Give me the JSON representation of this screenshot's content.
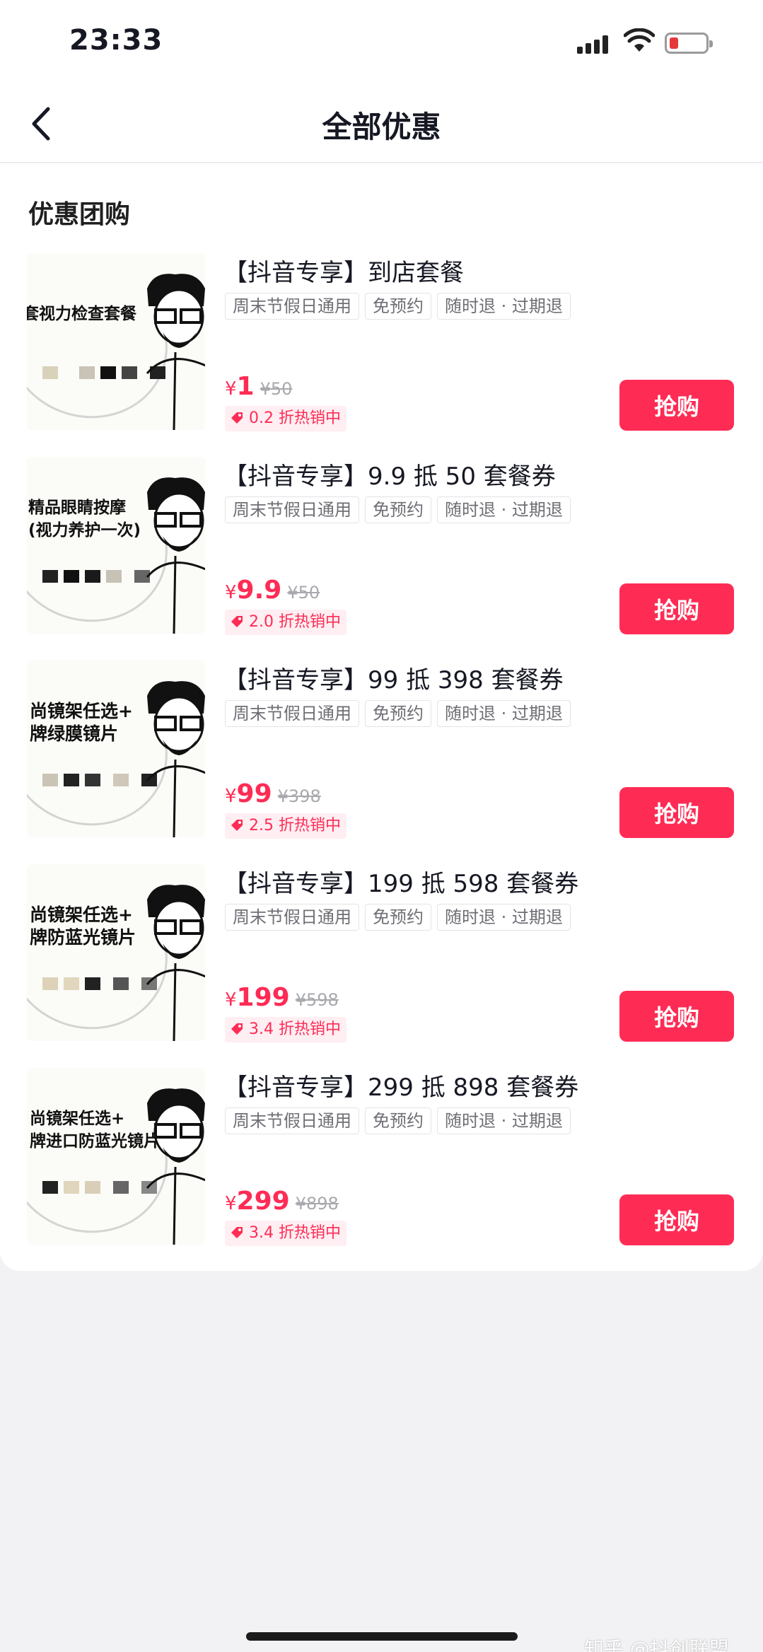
{
  "status_bar": {
    "time": "23:33"
  },
  "nav": {
    "title": "全部优惠"
  },
  "section": {
    "title": "优惠团购"
  },
  "deals": [
    {
      "title": "【抖音专享】到店套餐",
      "image_caption": "套视力检查套餐",
      "tags": [
        "周末节假日通用",
        "免预约",
        "随时退 · 过期退"
      ],
      "currency": "¥",
      "price": "1",
      "original_price": "¥50",
      "discount": "0.2 折热销中",
      "buy_label": "抢购"
    },
    {
      "title": "【抖音专享】9.9 抵 50 套餐券",
      "image_caption": "精品眼睛按摩\n(视力养护一次)",
      "tags": [
        "周末节假日通用",
        "免预约",
        "随时退 · 过期退"
      ],
      "currency": "¥",
      "price": "9.9",
      "original_price": "¥50",
      "discount": "2.0 折热销中",
      "buy_label": "抢购"
    },
    {
      "title": "【抖音专享】99 抵 398 套餐券",
      "image_caption": "尚镜架任选+\n牌绿膜镜片",
      "tags": [
        "周末节假日通用",
        "免预约",
        "随时退 · 过期退"
      ],
      "currency": "¥",
      "price": "99",
      "original_price": "¥398",
      "discount": "2.5 折热销中",
      "buy_label": "抢购"
    },
    {
      "title": "【抖音专享】199 抵 598 套餐券",
      "image_caption": "尚镜架任选+\n牌防蓝光镜片",
      "tags": [
        "周末节假日通用",
        "免预约",
        "随时退 · 过期退"
      ],
      "currency": "¥",
      "price": "199",
      "original_price": "¥598",
      "discount": "3.4 折热销中",
      "buy_label": "抢购"
    },
    {
      "title": "【抖音专享】299 抵 898 套餐券",
      "image_caption": "尚镜架任选+\n牌进口防蓝光镜片",
      "tags": [
        "周末节假日通用",
        "免预约",
        "随时退 · 过期退"
      ],
      "currency": "¥",
      "price": "299",
      "original_price": "¥898",
      "discount": "3.4 折热销中",
      "buy_label": "抢购"
    }
  ],
  "watermark": "知乎 @抖创联盟",
  "colors": {
    "accent": "#fe2c55",
    "tag_border": "#e4e4e6",
    "background": "#f2f2f4"
  }
}
